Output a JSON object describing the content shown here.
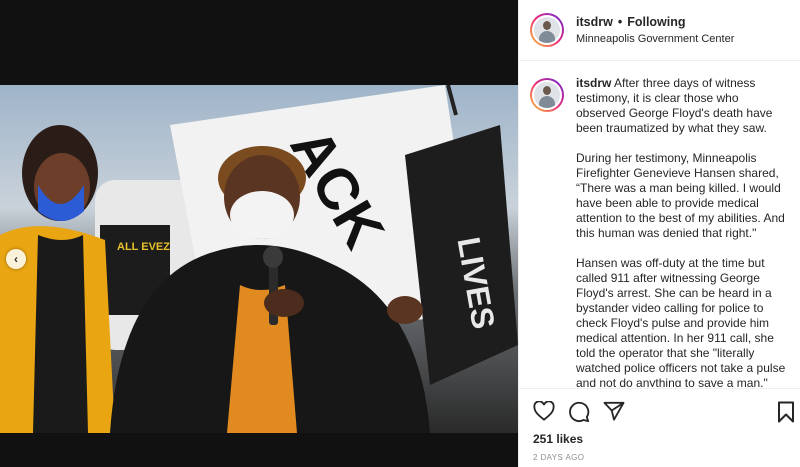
{
  "post": {
    "username": "itsdrw",
    "separator": "•",
    "follow_status": "Following",
    "location": "Minneapolis Government Center",
    "caption_paragraphs": [
      "After three days of witness testimony, it is clear those who observed George Floyd's death have been traumatized by what they saw.",
      "During her testimony, Minneapolis Firefighter Genevieve Hansen shared, “There was a man being killed. I would have been able to provide medical attention to the best of my abilities. And this human was denied that right.\"",
      "Hansen was off-duty at the time but called 911 after witnessing George Floyd's arrest. She can be heard in a bystander video calling for police to check Floyd's pulse and provide him medical attention. In her 911 call, she told the operator that she \"literally watched police officers not take a pulse and not do anything to save a man.\""
    ],
    "likes": "251 likes",
    "timestamp": "2 DAYS AGO"
  },
  "photo": {
    "carousel_prev_glyph": "‹",
    "poster_text": "ALL EVEZ",
    "flag_text_1": "ACK",
    "flag_text_2": "LIVES"
  },
  "icons": {
    "like": "heart-icon",
    "comment": "comment-icon",
    "share": "paper-plane-icon",
    "save": "bookmark-icon"
  }
}
